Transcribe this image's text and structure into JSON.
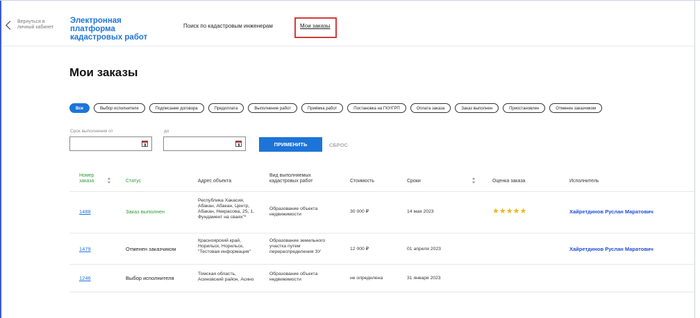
{
  "header": {
    "back_label": "Вернуться в личный кабинет",
    "brand": "Электронная платформа кадастровых работ",
    "nav": [
      {
        "label": "Поиск по кадастровым инженерам"
      },
      {
        "label": "Мои заказы",
        "active": true
      }
    ]
  },
  "page": {
    "title": "Мои заказы"
  },
  "filters": {
    "chips": [
      {
        "label": "Все",
        "active": true
      },
      {
        "label": "Выбор исполнителя"
      },
      {
        "label": "Подписание договора"
      },
      {
        "label": "Предоплата"
      },
      {
        "label": "Выполнение работ"
      },
      {
        "label": "Приёмка работ"
      },
      {
        "label": "Постановка на ГКУ/ГРП"
      },
      {
        "label": "Оплата заказа"
      },
      {
        "label": "Заказ выполнен"
      },
      {
        "label": "Приостановлен"
      },
      {
        "label": "Отменен заказчиком"
      }
    ],
    "date_from_label": "Срок выполнения от",
    "date_to_label": "до",
    "date_from_value": "",
    "date_to_value": "",
    "apply_label": "ПРИМЕНИТЬ",
    "reset_label": "СБРОС"
  },
  "table": {
    "columns": [
      "Номер заказа",
      "Статус",
      "Адрес объекта",
      "Вид выполняемых кадастровых работ",
      "Стоимость",
      "Сроки",
      "Оценка заказа",
      "Исполнитель"
    ],
    "rows": [
      {
        "number": "1488",
        "status": "Заказ выполнен",
        "status_color": "#2e9a3a",
        "address": "Республика Хакасия, Абакан, Абакан, Центр, Абакан, Некрасова, 25, 1, Фундамент на сваях\"*",
        "work_type": "Образование объекта недвижимости",
        "cost": "30 000 ₽",
        "deadline": "14 мая 2023",
        "rating": 5,
        "executor": "Хайретдинов Руслан Маратович"
      },
      {
        "number": "1479",
        "status": "Отменен заказчиком",
        "address": "Красноярский край, Норильск, Норильск, \"Тестовая информация\"",
        "work_type": "Образование земельного участка путем перераспределения ЗУ",
        "cost": "12 000 ₽",
        "deadline": "01 апреля 2023",
        "rating": 0,
        "executor": "Хайретдинов Руслан Маратович"
      },
      {
        "number": "1246",
        "status": "Выбор исполнителя",
        "address": "Томская область, Асиновский район, Асино",
        "work_type": "Образование объекта недвижимости",
        "cost": "не определена",
        "deadline": "31 января 2023",
        "rating": 0,
        "executor": ""
      }
    ]
  },
  "colors": {
    "accent": "#1d74d8",
    "success": "#2e9a3a",
    "highlight_border": "#d33a3a",
    "star": "#f0b418"
  }
}
